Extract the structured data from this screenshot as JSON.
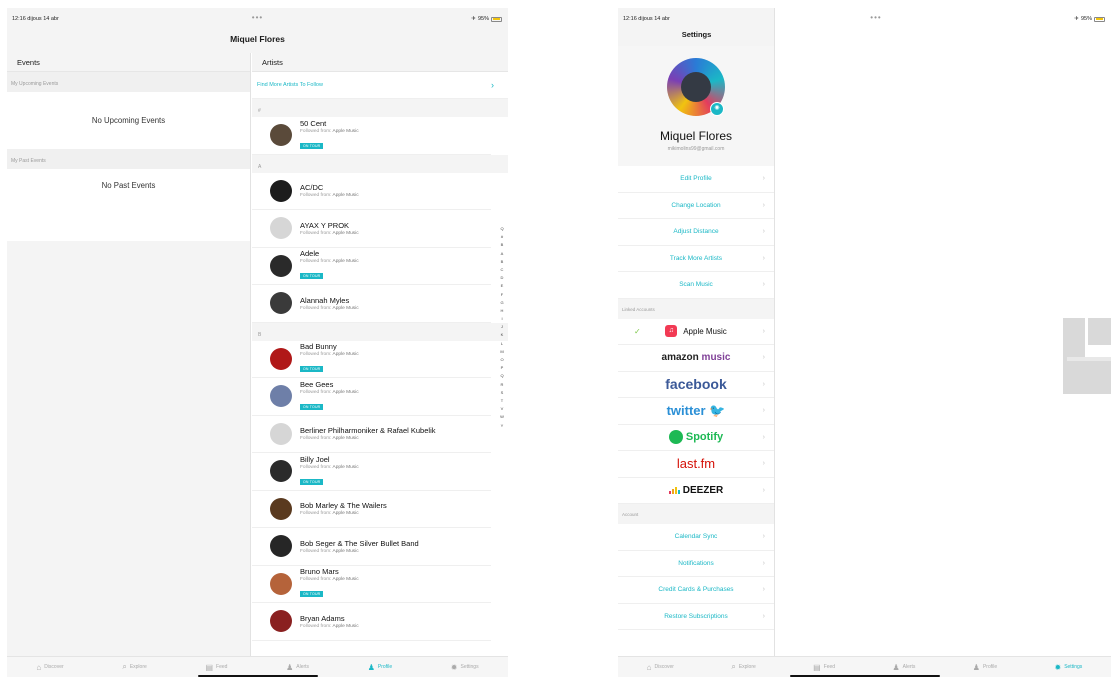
{
  "left_screen": {
    "status": {
      "time": "12:16  dijous 14 abr",
      "battery": "95%"
    },
    "title": "Miquel Flores",
    "events": {
      "heading": "Events",
      "upcoming_label": "My Upcoming Events",
      "upcoming_empty": "No Upcoming Events",
      "past_label": "My Past Events",
      "past_empty": "No Past Events"
    },
    "artists": {
      "heading": "Artists",
      "find_more": "Find More Artists To Follow",
      "followed_prefix": "Followed from:",
      "followed_source": "Apple Music",
      "on_tour": "ON TOUR",
      "sections": [
        {
          "letter": "#",
          "items": [
            {
              "name": "50 Cent",
              "on_tour": true,
              "avatar_color": "#5a4a3a"
            }
          ]
        },
        {
          "letter": "A",
          "items": [
            {
              "name": "AC/DC",
              "on_tour": false,
              "avatar_color": "#1c1c1c"
            },
            {
              "name": "AYAX Y PROK",
              "on_tour": false,
              "avatar_color": "#d6d6d6"
            },
            {
              "name": "Adele",
              "on_tour": true,
              "avatar_color": "#2a2a2a"
            },
            {
              "name": "Alannah Myles",
              "on_tour": false,
              "avatar_color": "#3a3a3a"
            }
          ]
        },
        {
          "letter": "B",
          "items": [
            {
              "name": "Bad Bunny",
              "on_tour": true,
              "avatar_color": "#b01818"
            },
            {
              "name": "Bee Gees",
              "on_tour": true,
              "avatar_color": "#6e7fa8"
            },
            {
              "name": "Berliner Philharmoniker & Rafael Kubelik",
              "on_tour": false,
              "avatar_color": "#d6d6d6"
            },
            {
              "name": "Billy Joel",
              "on_tour": true,
              "avatar_color": "#2b2b2b"
            },
            {
              "name": "Bob Marley & The Wailers",
              "on_tour": false,
              "avatar_color": "#5a3a1f"
            },
            {
              "name": "Bob Seger & The Silver Bullet Band",
              "on_tour": false,
              "avatar_color": "#262626"
            },
            {
              "name": "Bruno Mars",
              "on_tour": true,
              "avatar_color": "#b5633a"
            },
            {
              "name": "Bryan Adams",
              "on_tour": false,
              "avatar_color": "#8a2020"
            }
          ]
        }
      ],
      "index": [
        "Q",
        "#",
        "B",
        "A",
        "B",
        "C",
        "D",
        "E",
        "F",
        "G",
        "H",
        "I",
        "J",
        "K",
        "L",
        "M",
        "O",
        "P",
        "Q",
        "R",
        "S",
        "T",
        "V",
        "W",
        "Y"
      ]
    },
    "tabs": [
      {
        "label": "Discover",
        "icon": "home-icon",
        "glyph": "⌂",
        "active": false
      },
      {
        "label": "Explore",
        "icon": "search-icon",
        "glyph": "⌕",
        "active": false
      },
      {
        "label": "Feed",
        "icon": "feed-icon",
        "glyph": "▤",
        "active": false
      },
      {
        "label": "Alerts",
        "icon": "bell-icon",
        "glyph": "♟",
        "active": false
      },
      {
        "label": "Profile",
        "icon": "profile-icon",
        "glyph": "♟",
        "active": true
      },
      {
        "label": "Settings",
        "icon": "gear-icon",
        "glyph": "✹",
        "active": false
      }
    ]
  },
  "right_screen": {
    "status": {
      "time": "12:16  dijous 14 abr",
      "battery": "95%"
    },
    "title": "Settings",
    "profile": {
      "name": "Miquel Flores",
      "email": "mikimolins99@gmail.com"
    },
    "menu": [
      "Edit Profile",
      "Change Location",
      "Adjust Distance",
      "Track More Artists",
      "Scan Music"
    ],
    "linked_label": "Linked Accounts",
    "linked": {
      "apple_music": "Apple Music",
      "amazon_main": "amazon",
      "amazon_accent": "music",
      "facebook": "facebook",
      "twitter": "twitter",
      "spotify": "Spotify",
      "lastfm": "last.fm",
      "deezer": "DEEZER"
    },
    "account_label": "Account",
    "account_menu": [
      "Calendar Sync",
      "Notifications",
      "Credit Cards & Purchases",
      "Restore Subscriptions"
    ],
    "tabs": [
      {
        "label": "Discover",
        "icon": "home-icon",
        "glyph": "⌂",
        "active": false
      },
      {
        "label": "Explore",
        "icon": "search-icon",
        "glyph": "⌕",
        "active": false
      },
      {
        "label": "Feed",
        "icon": "feed-icon",
        "glyph": "▤",
        "active": false
      },
      {
        "label": "Alerts",
        "icon": "bell-icon",
        "glyph": "♟",
        "active": false
      },
      {
        "label": "Profile",
        "icon": "profile-icon",
        "glyph": "♟",
        "active": false
      },
      {
        "label": "Settings",
        "icon": "gear-icon",
        "glyph": "✹",
        "active": true
      }
    ]
  },
  "colors": {
    "accent": "#1bb8c6",
    "check": "#7ec84a"
  }
}
